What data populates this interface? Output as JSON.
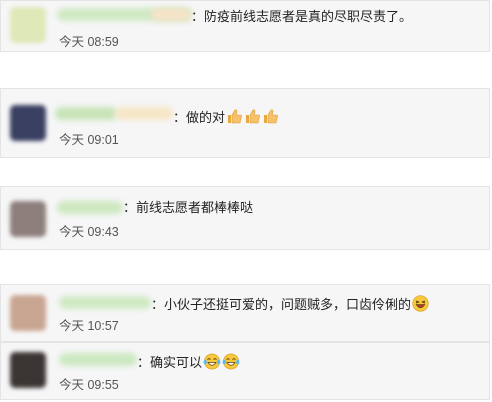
{
  "comments": [
    {
      "text": "：防疫前线志愿者是真的尽职尽责了。",
      "time": "今天 08:59",
      "emoji": []
    },
    {
      "text": "：做的对",
      "time": "今天 09:01",
      "emoji": [
        "thumbs-up-icon",
        "thumbs-up-icon",
        "thumbs-up-icon"
      ]
    },
    {
      "text": "：前线志愿者都棒棒哒",
      "time": "今天 09:43",
      "emoji": []
    },
    {
      "text": "：小伙子还挺可爱的，问题贼多，口齿伶俐的",
      "time": "今天 10:57",
      "emoji": [
        "laughing-face-icon"
      ]
    },
    {
      "text": "：确实可以",
      "time": "今天 09:55",
      "emoji": [
        "tears-of-joy-face-icon",
        "tears-of-joy-face-icon"
      ]
    }
  ],
  "colors": {
    "card_bg": "#f6f6f7",
    "card_border": "#e4e4e4",
    "text": "#222222",
    "time": "#555555",
    "name_blur": "#c8e6b9"
  }
}
